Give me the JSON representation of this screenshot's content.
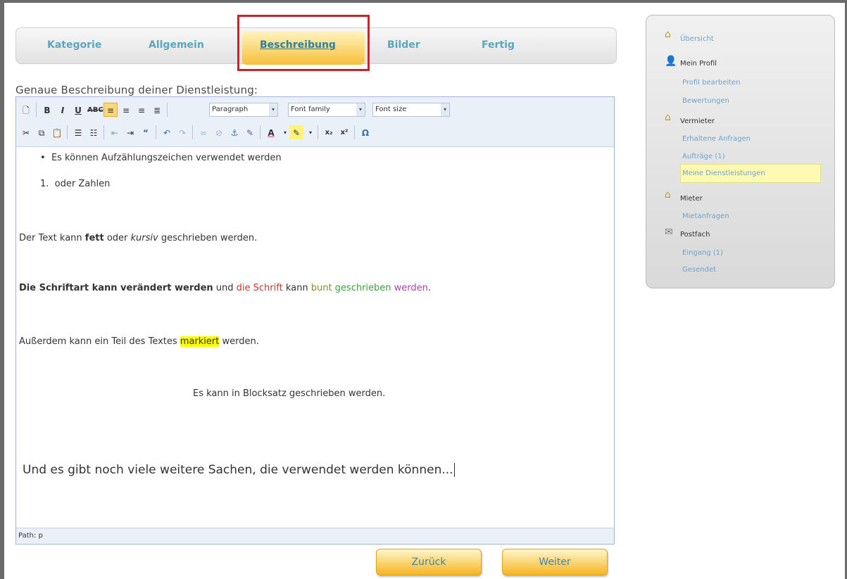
{
  "tabs": [
    "Kategorie",
    "Allgemein",
    "Beschreibung",
    "Bilder",
    "Fertig"
  ],
  "heading": "Genaue Beschreibung deiner Dienstleistung:",
  "toolbar": {
    "paragraph": "Paragraph",
    "font_family": "Font family",
    "font_size": "Font size"
  },
  "editor": {
    "bullet": "Es können Aufzählungszeichen verwendet werden",
    "numbered_prefix": "1.",
    "numbered": "oder Zahlen",
    "line1_a": "Der Text kann ",
    "line1_bold": "fett",
    "line1_b": " oder ",
    "line1_italic": "kursiv",
    "line1_c": " geschrieben werden.",
    "line2_bold": "Die Schriftart kann verändert werden",
    "line2_a": " und ",
    "line2_red": "die Schrift",
    "line2_b": " kann ",
    "line2_olive": "bunt",
    "line2_green": " geschrieben",
    "line2_magenta": " werden",
    "line2_end": ".",
    "line3_a": "Außerdem kann ein Teil des Textes ",
    "line3_mark": "markiert",
    "line3_b": " werden.",
    "line4": "Es kann in Blocksatz geschrieben werden.",
    "line5": "Und es gibt noch viele weitere Sachen, die verwendet werden können...",
    "path": "Path: p"
  },
  "buttons": {
    "back": "Zurück",
    "next": "Weiter"
  },
  "sidebar": {
    "overview": "Übersicht",
    "my_profile": "Mein Profil",
    "edit_profile": "Profil bearbeiten",
    "ratings": "Bewertungen",
    "landlord": "Vermieter",
    "received_requests": "Erhaltene Anfragen",
    "orders": "Aufträge (1)",
    "my_services": "Meine Dienstleistungen",
    "tenant": "Mieter",
    "rental_requests": "Mietanfragen",
    "mailbox": "Postfach",
    "inbox": "Eingang (1)",
    "sent": "Gesendet"
  },
  "colors": {
    "accent": "#f5b521",
    "tab_text": "#5ba6be",
    "highlight": "#ffff00",
    "red_frame": "#c4262b"
  }
}
